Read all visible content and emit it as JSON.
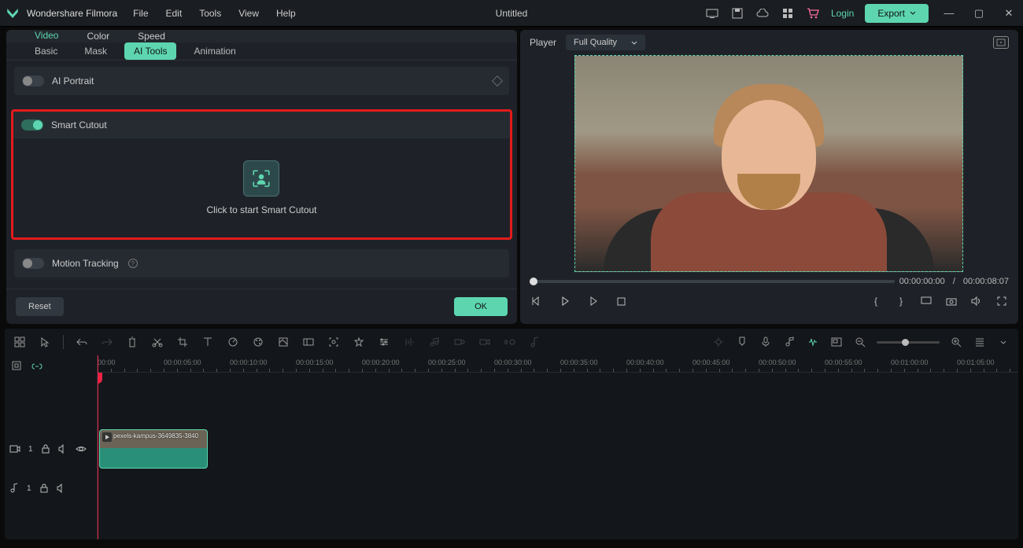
{
  "title": {
    "appname": "Wondershare Filmora",
    "document": "Untitled"
  },
  "menubar": [
    "File",
    "Edit",
    "Tools",
    "View",
    "Help"
  ],
  "topicons": {
    "login": "Login",
    "export": "Export"
  },
  "left_panel": {
    "main_tabs": [
      "Video",
      "Color",
      "Speed"
    ],
    "sub_tabs": [
      "Basic",
      "Mask",
      "AI Tools",
      "Animation"
    ],
    "ai_portrait": "AI Portrait",
    "smart_cutout": {
      "title": "Smart Cutout",
      "hint": "Click to start Smart Cutout"
    },
    "motion_tracking": "Motion Tracking",
    "reset": "Reset",
    "ok": "OK"
  },
  "player": {
    "label": "Player",
    "quality": "Full Quality",
    "time_current": "00:00:00:00",
    "time_total": "00:00:08:07",
    "sep": "/"
  },
  "timeline": {
    "ruler": [
      "00:00",
      "00:00:05:00",
      "00:00:10:00",
      "00:00:15:00",
      "00:00:20:00",
      "00:00:25:00",
      "00:00:30:00",
      "00:00:35:00",
      "00:00:40:00",
      "00:00:45:00",
      "00:00:50:00",
      "00:00:55:00",
      "00:01:00:00",
      "00:01:05:00"
    ],
    "video_track": "1",
    "audio_track": "1",
    "clip_name": "pexels-kampus-3649835-3840"
  }
}
